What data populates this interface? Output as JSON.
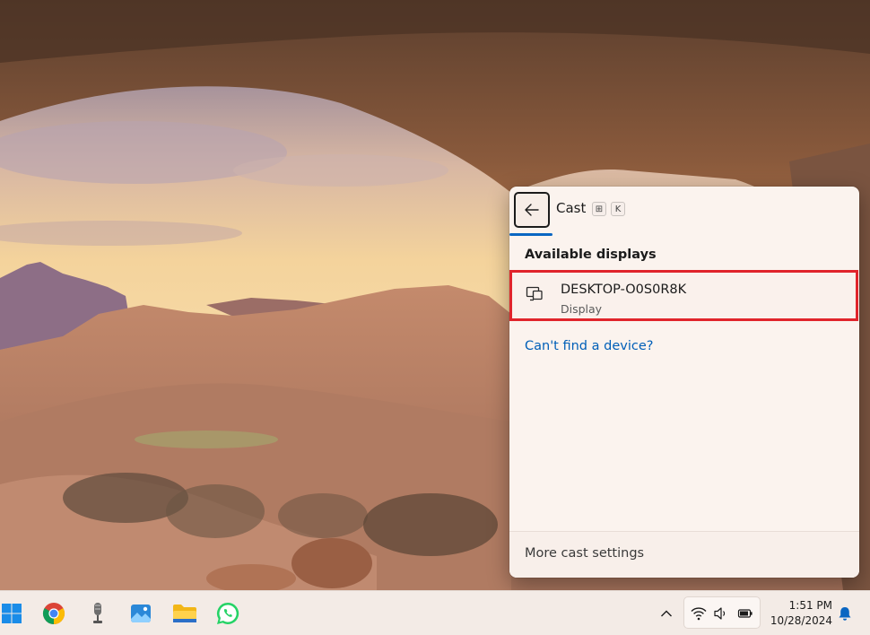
{
  "cast_panel": {
    "title": "Cast",
    "shortcut": [
      "⊞",
      "K"
    ],
    "section_label": "Available displays",
    "devices": [
      {
        "name": "DESKTOP-O0S0R8K",
        "type": "Display"
      }
    ],
    "help_link": "Can't find a device?",
    "footer_link": "More cast settings"
  },
  "taskbar": {
    "apps": [
      "start-icon",
      "chrome-icon",
      "microphone-icon",
      "photos-icon",
      "file-explorer-icon",
      "whatsapp-icon"
    ],
    "tray": [
      "wifi-icon",
      "volume-icon",
      "battery-icon"
    ],
    "time": "1:51 PM",
    "date": "10/28/2024"
  },
  "colors": {
    "accent": "#005fb8",
    "highlight_border": "#e0242b",
    "flyout_bg": "#fbf3ee",
    "taskbar_bg": "#f3ebe6"
  }
}
